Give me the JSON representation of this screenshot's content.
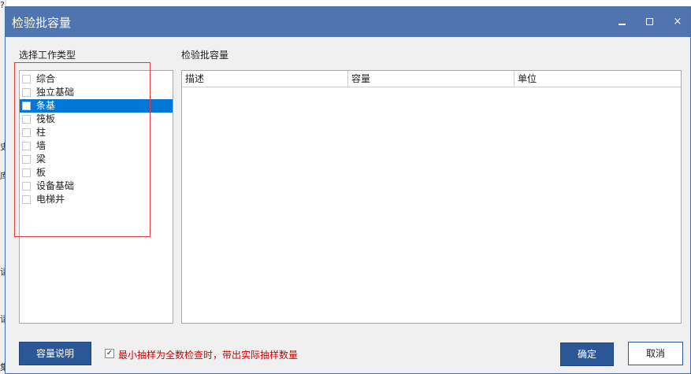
{
  "background": {
    "glyphs": [
      "?",
      "史",
      "库",
      "请",
      "请",
      "集"
    ]
  },
  "dialog": {
    "title": "检验批容量",
    "left_label": "选择工作类型",
    "right_label": "检验批容量",
    "work_types": [
      {
        "label": "综合",
        "checked": false,
        "selected": false
      },
      {
        "label": "独立基础",
        "checked": false,
        "selected": false
      },
      {
        "label": "条基",
        "checked": false,
        "selected": true
      },
      {
        "label": "筏板",
        "checked": false,
        "selected": false
      },
      {
        "label": "柱",
        "checked": false,
        "selected": false
      },
      {
        "label": "墙",
        "checked": false,
        "selected": false
      },
      {
        "label": "梁",
        "checked": false,
        "selected": false
      },
      {
        "label": "板",
        "checked": false,
        "selected": false
      },
      {
        "label": "设备基础",
        "checked": false,
        "selected": false
      },
      {
        "label": "电梯井",
        "checked": false,
        "selected": false
      }
    ],
    "table": {
      "columns": [
        "描述",
        "容量",
        "单位"
      ],
      "rows": []
    },
    "capacity_button": "容量说明",
    "checkbox_label": "最小抽样为全数检查时，带出实际抽样数量",
    "checkbox_checked": true,
    "checkbox_mark": "✓",
    "ok_button": "确定",
    "cancel_button": "取消",
    "close_glyph": "×",
    "colors": {
      "titlebar": "#4f74b0",
      "selection": "#0078d7",
      "primary_button": "#2b5797",
      "warning_text": "#d40000",
      "highlight_box": "#e23b3b"
    }
  }
}
